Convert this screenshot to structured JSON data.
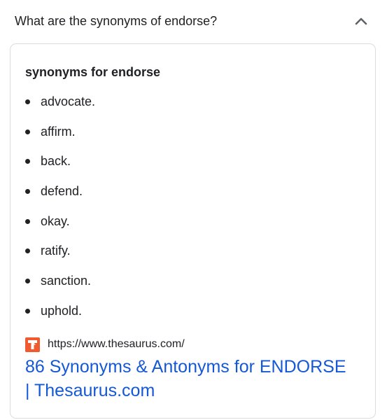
{
  "faq": {
    "question": "What are the synonyms of endorse?",
    "collapse_icon": "chevron-up-icon"
  },
  "card": {
    "heading": "synonyms for endorse",
    "synonyms": [
      "advocate.",
      "affirm.",
      "back.",
      "defend.",
      "okay.",
      "ratify.",
      "sanction.",
      "uphold."
    ],
    "source": {
      "favicon": "thesaurus-favicon-icon",
      "favicon_color": "#ef5a31",
      "url": "https://www.thesaurus.com/",
      "title": "86 Synonyms & Antonyms for ENDORSE | Thesaurus.com",
      "link_color": "#1558d6"
    }
  }
}
